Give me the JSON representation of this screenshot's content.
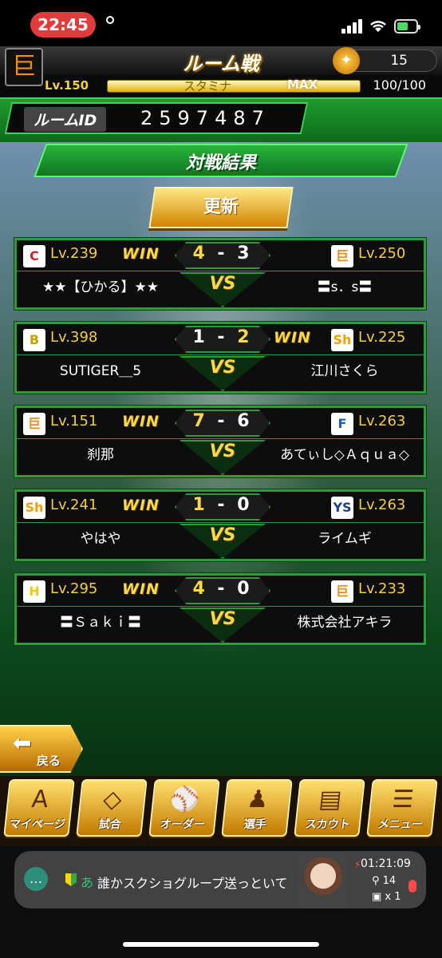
{
  "status": {
    "time": "22:45"
  },
  "header": {
    "title": "ルーム戦",
    "team_logo": "巨",
    "coins": "15",
    "level": "Lv.150",
    "stamina_label": "スタミナ",
    "stamina_max": "MAX",
    "stamina_value": "100/100"
  },
  "room": {
    "label": "ルームID",
    "id": "2597487"
  },
  "section": {
    "title": "対戦結果",
    "refresh_label": "更新"
  },
  "vs_label": "VS",
  "win_label": "WIN",
  "matches": [
    {
      "left": {
        "logo": "C",
        "logo_color": "#d0202a",
        "level": "Lv.239",
        "name": "★★【ひかる】★★",
        "win": true
      },
      "score_left": "4",
      "score_right": "3",
      "right": {
        "logo": "巨",
        "logo_color": "#f08b1c",
        "level": "Lv.250",
        "name": "〓s．s〓",
        "win": false
      }
    },
    {
      "left": {
        "logo": "B",
        "logo_color": "#c9a100",
        "level": "Lv.398",
        "name": "SUTIGER＿5",
        "win": false
      },
      "score_left": "1",
      "score_right": "2",
      "right": {
        "logo": "Sh",
        "logo_color": "#f0a000",
        "level": "Lv.225",
        "name": "江川さくら",
        "win": true
      }
    },
    {
      "left": {
        "logo": "巨",
        "logo_color": "#f08b1c",
        "level": "Lv.151",
        "name": "刹那",
        "win": true
      },
      "score_left": "7",
      "score_right": "6",
      "right": {
        "logo": "F",
        "logo_color": "#1d5fb8",
        "level": "Lv.263",
        "name": "あてぃし◇Ａｑｕａ◇",
        "win": false
      }
    },
    {
      "left": {
        "logo": "Sh",
        "logo_color": "#f0a000",
        "level": "Lv.241",
        "name": "やはや",
        "win": true
      },
      "score_left": "1",
      "score_right": "0",
      "right": {
        "logo": "YS",
        "logo_color": "#1c3e8c",
        "level": "Lv.263",
        "name": "ライムギ",
        "win": false
      }
    },
    {
      "left": {
        "logo": "H",
        "logo_color": "#f3c800",
        "level": "Lv.295",
        "name": "〓Ｓａｋｉ〓",
        "win": true
      },
      "score_left": "4",
      "score_right": "0",
      "right": {
        "logo": "巨",
        "logo_color": "#f08b1c",
        "level": "Lv.233",
        "name": "株式会社アキラ",
        "win": false
      }
    }
  ],
  "back_label": "戻る",
  "menu": [
    {
      "label": "マイページ",
      "icon": "A"
    },
    {
      "label": "試合",
      "icon": "◇"
    },
    {
      "label": "オーダー",
      "icon": "⚾"
    },
    {
      "label": "選手",
      "icon": "♟"
    },
    {
      "label": "スカウト",
      "icon": "▤"
    },
    {
      "label": "メニュー",
      "icon": "☰"
    }
  ],
  "notification": {
    "user": "あ",
    "text": "誰かスクショグループ送っといて",
    "live_time": "01:21:09",
    "viewers": "14",
    "gifts": "x 1"
  },
  "colors": {
    "accent_green": "#2e9b3b",
    "gold": "#ffd84a",
    "level_text": "#f4cf3c"
  }
}
